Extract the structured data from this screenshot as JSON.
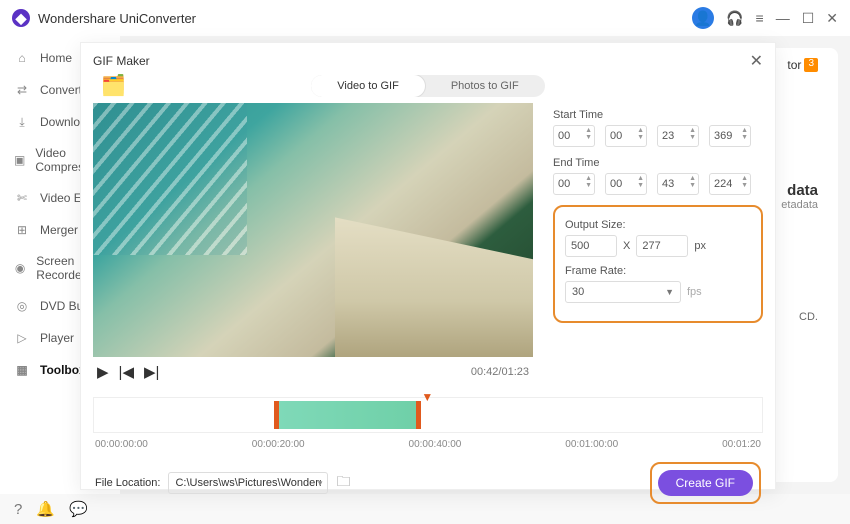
{
  "app": {
    "title": "Wondershare UniConverter"
  },
  "sidebar": {
    "items": [
      {
        "icon": "⌂",
        "label": "Home"
      },
      {
        "icon": "⇄",
        "label": "Converter"
      },
      {
        "icon": "⤓",
        "label": "Downloader"
      },
      {
        "icon": "▣",
        "label": "Video Compressor"
      },
      {
        "icon": "✄",
        "label": "Video Editor"
      },
      {
        "icon": "⊞",
        "label": "Merger"
      },
      {
        "icon": "◉",
        "label": "Screen Recorder"
      },
      {
        "icon": "◎",
        "label": "DVD Burner"
      },
      {
        "icon": "▷",
        "label": "Player"
      },
      {
        "icon": "▦",
        "label": "Toolbox"
      }
    ]
  },
  "bg": {
    "feat1": "tor",
    "badge": "3",
    "metaTitle": "data",
    "metaSub": "etadata",
    "cd": "CD."
  },
  "modal": {
    "title": "GIF Maker",
    "tabs": {
      "video": "Video to GIF",
      "photos": "Photos to GIF"
    },
    "player": {
      "time": "00:42/01:23"
    },
    "startLabel": "Start Time",
    "start": [
      "00",
      "00",
      "23",
      "369"
    ],
    "endLabel": "End Time",
    "end": [
      "00",
      "00",
      "43",
      "224"
    ],
    "outSizeLabel": "Output Size:",
    "w": "500",
    "x": "X",
    "h": "277",
    "px": "px",
    "frLabel": "Frame Rate:",
    "fr": "30",
    "fps": "fps",
    "ticks": [
      "00:00:00:00",
      "00:00:20:00",
      "00:00:40:00",
      "00:01:00:00",
      "00:01:20"
    ],
    "locLabel": "File Location:",
    "locVal": "C:\\Users\\ws\\Pictures\\Wonders",
    "create": "Create GIF"
  }
}
